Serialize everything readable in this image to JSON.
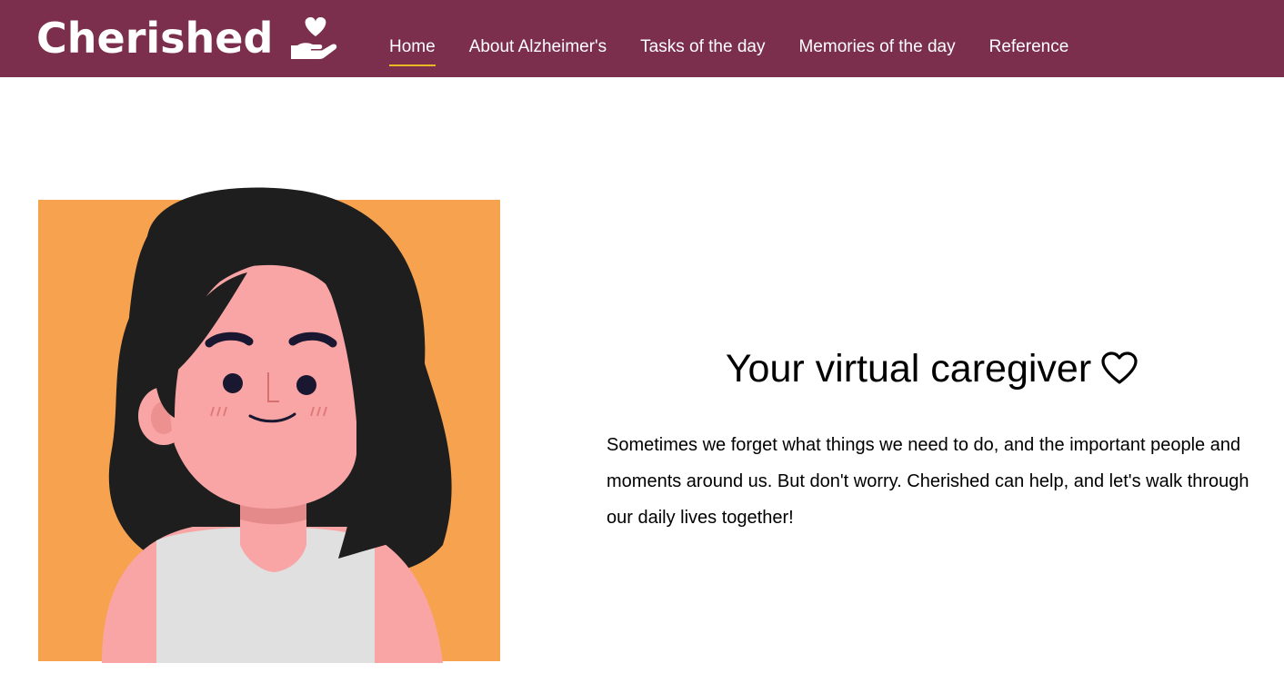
{
  "brand": {
    "name": "Cherished"
  },
  "nav": {
    "items": [
      {
        "label": "Home",
        "active": true
      },
      {
        "label": "About Alzheimer's",
        "active": false
      },
      {
        "label": "Tasks of the day",
        "active": false
      },
      {
        "label": "Memories of the day",
        "active": false
      },
      {
        "label": "Reference",
        "active": false
      }
    ]
  },
  "hero": {
    "title": "Your virtual caregiver",
    "body": "Sometimes we forget what things we need to do, and the important people and moments around us. But don't worry. Cherished can help, and let's walk through our daily lives together!"
  },
  "colors": {
    "navbar_bg": "#7b2f4c",
    "nav_active_underline": "#e8b923",
    "portrait_bg": "#f7a24f",
    "hair": "#1e1e1e",
    "skin": "#f9a5a5",
    "shirt": "#dfe0df"
  },
  "icons": {
    "brand": "heart-in-hand-icon",
    "title": "heart-outline-icon"
  }
}
